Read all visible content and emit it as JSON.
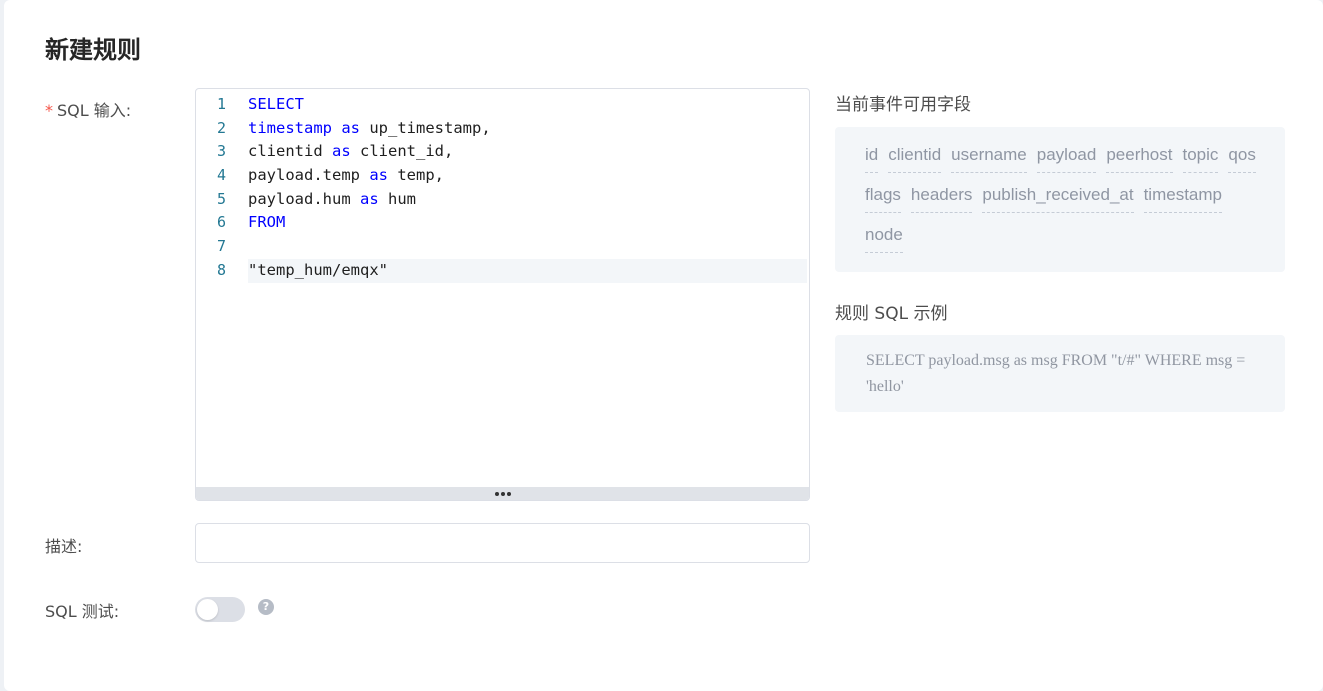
{
  "page": {
    "title": "新建规则"
  },
  "form": {
    "sql_label": "SQL 输入:",
    "required_mark": "*",
    "desc_label": "描述:",
    "desc_value": "",
    "test_label": "SQL 测试:",
    "test_enabled": false,
    "help_glyph": "?"
  },
  "editor": {
    "lines": [
      {
        "no": "1",
        "tokens": [
          {
            "t": "SELECT",
            "kw": true
          }
        ]
      },
      {
        "no": "2",
        "tokens": [
          {
            "t": "timestamp",
            "kw": true
          },
          {
            "t": " "
          },
          {
            "t": "as",
            "kw": true
          },
          {
            "t": " up_timestamp,"
          }
        ]
      },
      {
        "no": "3",
        "tokens": [
          {
            "t": "clientid "
          },
          {
            "t": "as",
            "kw": true
          },
          {
            "t": " client_id,"
          }
        ]
      },
      {
        "no": "4",
        "tokens": [
          {
            "t": "payload.temp "
          },
          {
            "t": "as",
            "kw": true
          },
          {
            "t": " temp,"
          }
        ]
      },
      {
        "no": "5",
        "tokens": [
          {
            "t": "payload.hum "
          },
          {
            "t": "as",
            "kw": true
          },
          {
            "t": " hum"
          }
        ]
      },
      {
        "no": "6",
        "tokens": [
          {
            "t": "FROM",
            "kw": true
          }
        ]
      },
      {
        "no": "7",
        "tokens": [
          {
            "t": ""
          }
        ]
      },
      {
        "no": "8",
        "tokens": [
          {
            "t": "\"temp_hum/emqx\""
          }
        ],
        "active": true
      }
    ]
  },
  "fields": {
    "title": "当前事件可用字段",
    "items": [
      "id",
      "clientid",
      "username",
      "payload",
      "peerhost",
      "topic",
      "qos",
      "flags",
      "headers",
      "publish_received_at",
      "timestamp",
      "node"
    ]
  },
  "example": {
    "title": "规则 SQL 示例",
    "sql": "SELECT payload.msg as msg FROM \"t/#\" WHERE msg = 'hello'"
  },
  "colors": {
    "keyword": "#0000ff",
    "line_number": "#237893",
    "required": "#f5564a",
    "panel_bg": "#f3f6f9"
  }
}
